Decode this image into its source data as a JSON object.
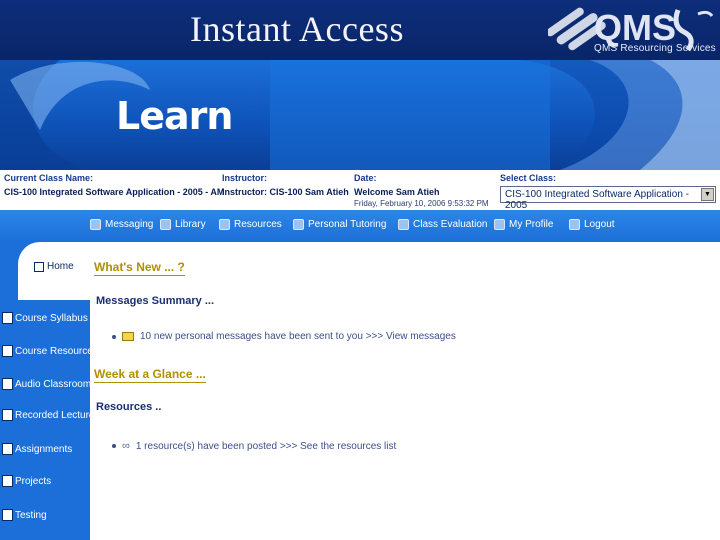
{
  "slide": {
    "title": "Instant Access",
    "logo_text": "QMS",
    "logo_tagline": "QMS Resourcing Services"
  },
  "banner": {
    "word": "Learn"
  },
  "info": {
    "class_label": "Current Class Name:",
    "class_value": "CIS-100 Integrated Software Application - 2005 - AM",
    "instructor_label": "Instructor:",
    "instructor_value": "Instructor: CIS-100 Sam Atieh",
    "date_label": "Date:",
    "date_welcome": "Welcome Sam Atieh",
    "date_value": "Friday, February 10, 2006 9:53:32 PM",
    "select_label": "Select Class:",
    "select_value": "CIS-100 Integrated Software Application - 2005"
  },
  "nav": [
    {
      "label": "Messaging",
      "icon": "envelope-icon"
    },
    {
      "label": "Library",
      "icon": "book-icon"
    },
    {
      "label": "Resources",
      "icon": "link-icon"
    },
    {
      "label": "Personal Tutoring",
      "icon": "people-icon"
    },
    {
      "label": "Class Evaluation",
      "icon": "pencil-icon"
    },
    {
      "label": "My Profile",
      "icon": "profile-icon"
    },
    {
      "label": "Logout",
      "icon": "door-icon"
    }
  ],
  "sidebar": {
    "home": "Home",
    "items": [
      "Course Syllabus",
      "Course Resources",
      "Audio Classroom",
      "Recorded Lectures",
      "Assignments",
      "Projects",
      "Testing"
    ]
  },
  "content": {
    "whats_new": "What's New ... ?",
    "messages_summary": "Messages Summary ...",
    "messages_text": "10 new personal messages have been sent to you >>> View messages",
    "week_glance": "Week at a Glance ...",
    "resources_heading": "Resources ..",
    "resources_text": "1 resource(s) have been posted >>> See the resources list"
  },
  "colors": {
    "banner": "#1c6fd8",
    "header": "#0b2f86",
    "accent_gold": "#b09000"
  }
}
